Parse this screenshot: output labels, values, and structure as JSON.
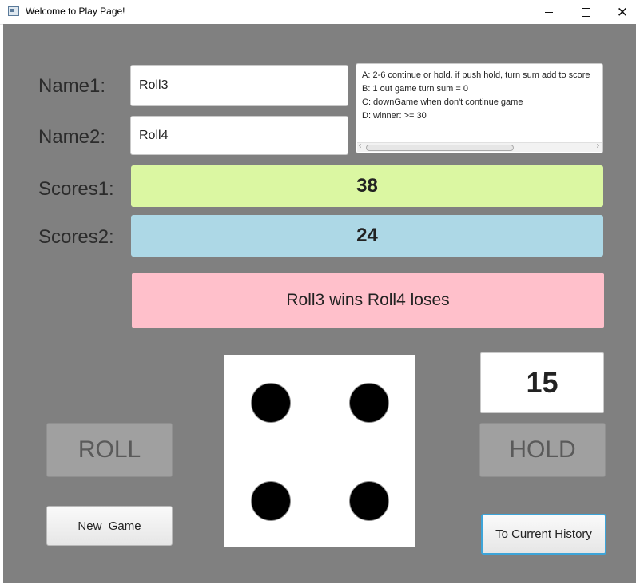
{
  "window": {
    "title": "Welcome to Play Page!",
    "minimize": "—",
    "maximize": "☐",
    "close": "✕"
  },
  "labels": {
    "name1": "Name1:",
    "name2": "Name2:",
    "scores1": "Scores1:",
    "scores2": "Scores2:"
  },
  "inputs": {
    "name1_value": "Roll3",
    "name2_value": "Roll4"
  },
  "rules": [
    "A: 2-6 continue or hold. if push hold, turn sum add to score",
    "B: 1 out game turn sum = 0",
    "C: downGame when don't continue game",
    "D: winner: >= 30"
  ],
  "scores": {
    "player1": "38",
    "player2": "24"
  },
  "result_text": "Roll3 wins Roll4 loses",
  "buttons": {
    "roll": "ROLL",
    "hold": "HOLD",
    "new_game": "New  Game",
    "history": "To Current History"
  },
  "turn_sum": "15",
  "die": {
    "face_value": 4
  },
  "colors": {
    "background": "#808080",
    "score1_bg": "#dbf7a2",
    "score2_bg": "#add8e6",
    "result_bg": "#ffc0cb",
    "history_focus_border": "#3da4d8"
  }
}
